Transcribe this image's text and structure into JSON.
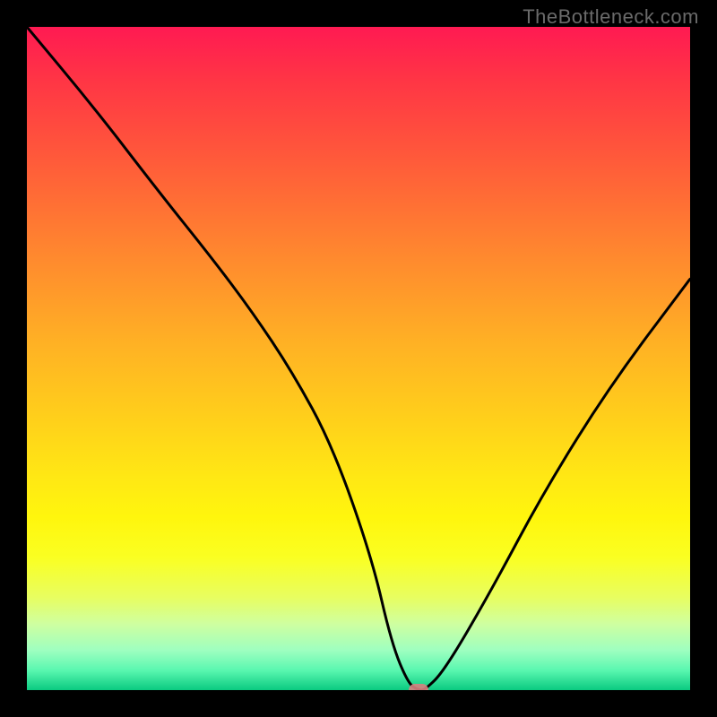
{
  "watermark": "TheBottleneck.com",
  "chart_data": {
    "type": "line",
    "title": "",
    "xlabel": "",
    "ylabel": "",
    "xlim": [
      0,
      100
    ],
    "ylim": [
      0,
      100
    ],
    "grid": false,
    "series": [
      {
        "name": "curve",
        "x": [
          0,
          10,
          20,
          28,
          34,
          40,
          46,
          52,
          55,
          57.5,
          59,
          60,
          63,
          70,
          78,
          88,
          100
        ],
        "values": [
          100,
          88,
          75,
          65,
          57,
          48,
          37,
          20,
          7,
          1,
          0,
          0,
          3,
          15,
          30,
          46,
          62
        ]
      }
    ],
    "marker": {
      "x": 59,
      "y": 0,
      "color": "#d88080"
    },
    "gradient_stops": [
      {
        "offset": 0,
        "color": "#ff1a52"
      },
      {
        "offset": 50,
        "color": "#ffd21a"
      },
      {
        "offset": 100,
        "color": "#0aca80"
      }
    ]
  }
}
